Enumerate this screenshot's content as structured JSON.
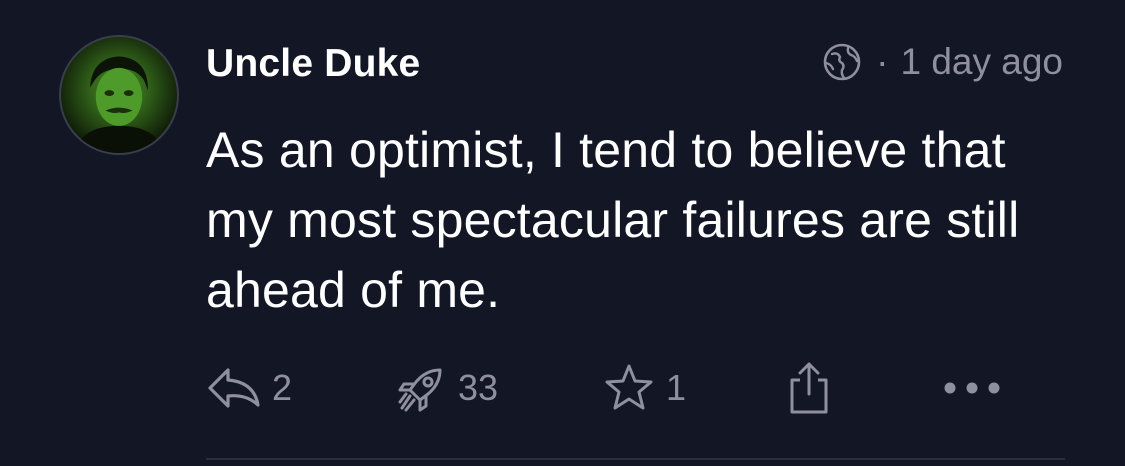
{
  "post": {
    "author": "Uncle Duke",
    "visibility_icon": "globe-icon",
    "separator": "·",
    "timestamp": "1 day ago",
    "content": "As an optimist, I tend to believe that my most spectacular failures are still ahead of me.",
    "avatar_tint": "#4b8f2a"
  },
  "actions": {
    "reply": {
      "icon": "reply-icon",
      "count": "2"
    },
    "boost": {
      "icon": "rocket-icon",
      "count": "33"
    },
    "favorite": {
      "icon": "star-icon",
      "count": "1"
    },
    "share": {
      "icon": "share-icon"
    },
    "more": {
      "icon": "more-icon"
    }
  },
  "colors": {
    "background": "#131624",
    "text": "#ffffff",
    "muted": "#8e90a0"
  }
}
